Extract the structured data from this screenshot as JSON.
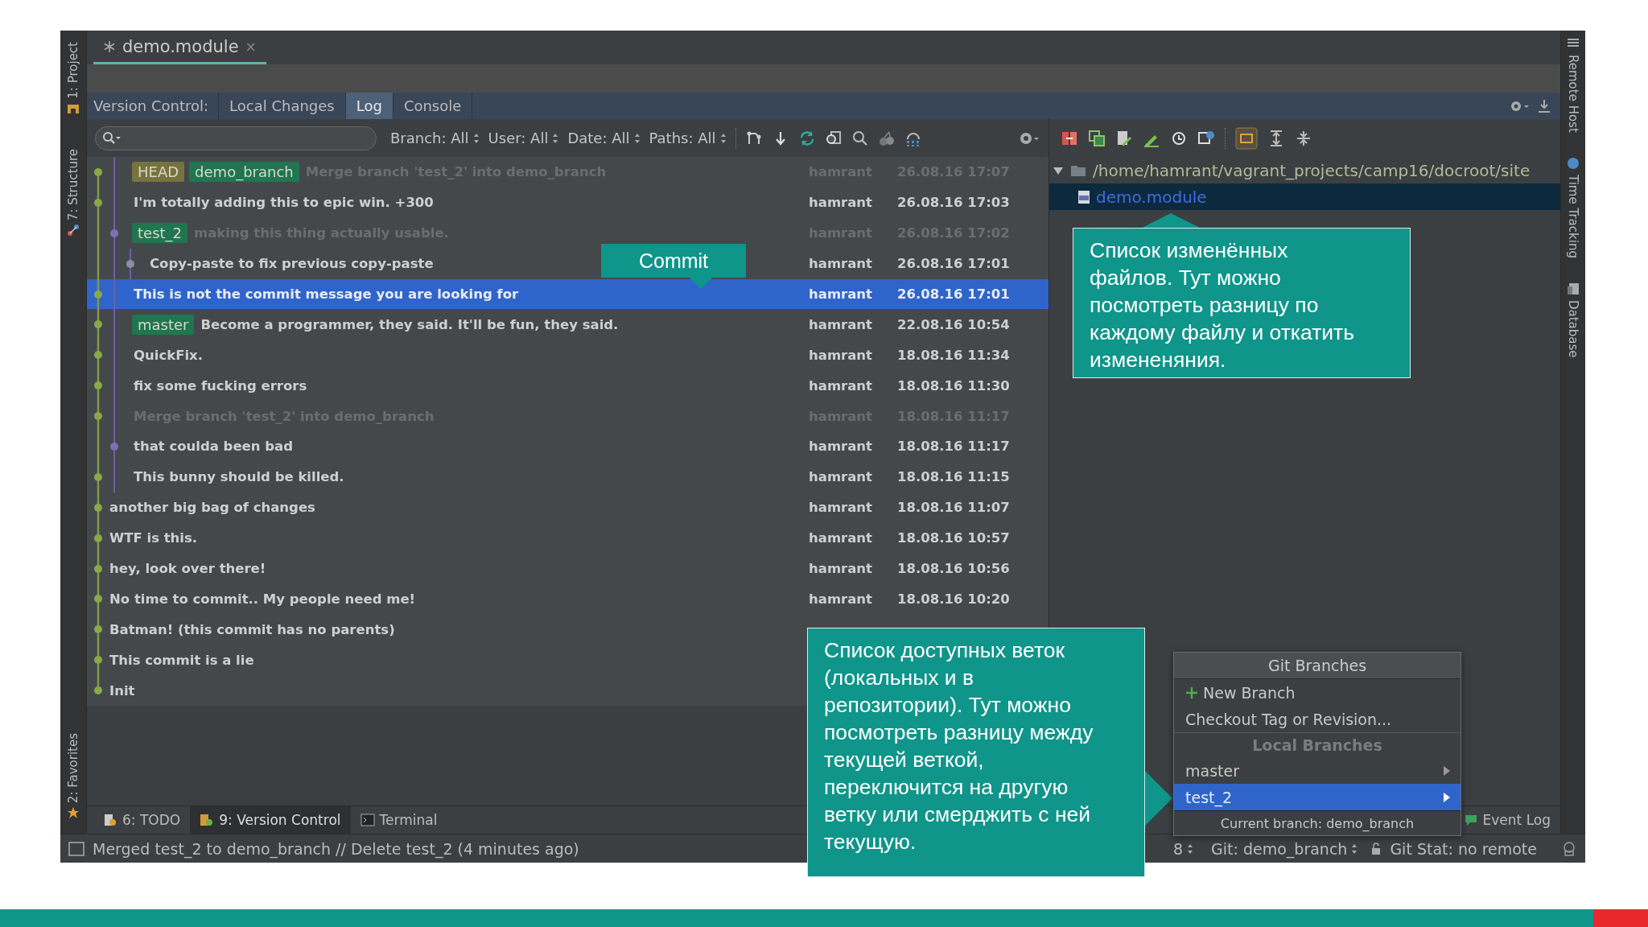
{
  "left_stripe": [
    {
      "label": "1: Project"
    },
    {
      "label": "7: Structure"
    },
    {
      "label": "2: Favorites"
    }
  ],
  "editor_tabs": [
    {
      "label": "demo.module",
      "close": "×",
      "selected": true
    }
  ],
  "vc_panel": {
    "title": "Version Control:",
    "tabs": [
      {
        "label": "Local Changes",
        "selected": false
      },
      {
        "label": "Log",
        "selected": true
      },
      {
        "label": "Console",
        "selected": false
      }
    ]
  },
  "filters": [
    "Branch: All",
    "User: All",
    "Date: All",
    "Paths: All"
  ],
  "log": {
    "rows": [
      {
        "refs": [
          {
            "label": "HEAD",
            "color": "#76733f"
          },
          {
            "label": "demo_branch",
            "color": "#1f7650"
          }
        ],
        "message": "Merge branch 'test_2' into demo_branch",
        "author": "hamrant",
        "date": "26.08.16 17:07",
        "dim": true,
        "selected": false
      },
      {
        "refs": [],
        "message": "I'm totally adding this to epic win. +300",
        "author": "hamrant",
        "date": "26.08.16 17:03",
        "dim": false,
        "selected": false
      },
      {
        "refs": [
          {
            "label": "test_2",
            "color": "#1f7650"
          }
        ],
        "message": "making this thing actually usable.",
        "author": "hamrant",
        "date": "26.08.16 17:02",
        "dim": true,
        "selected": false
      },
      {
        "refs": [],
        "message": "Copy-paste to fix previous copy-paste",
        "author": "hamrant",
        "date": "26.08.16 17:01",
        "dim": false,
        "selected": false
      },
      {
        "refs": [],
        "message": "This is not the commit message you are looking for",
        "author": "hamrant",
        "date": "26.08.16 17:01",
        "dim": false,
        "selected": true
      },
      {
        "refs": [
          {
            "label": "master",
            "color": "#1f7650"
          }
        ],
        "message": "Become a programmer, they said. It'll be fun, they said.",
        "author": "hamrant",
        "date": "22.08.16 10:54",
        "dim": false,
        "selected": false
      },
      {
        "refs": [],
        "message": "QuickFix.",
        "author": "hamrant",
        "date": "18.08.16 11:34",
        "dim": false,
        "selected": false
      },
      {
        "refs": [],
        "message": "fix some fucking errors",
        "author": "hamrant",
        "date": "18.08.16 11:30",
        "dim": false,
        "selected": false
      },
      {
        "refs": [],
        "message": "Merge branch 'test_2' into demo_branch",
        "author": "hamrant",
        "date": "18.08.16 11:17",
        "dim": true,
        "selected": false
      },
      {
        "refs": [],
        "message": "that coulda been bad",
        "author": "hamrant",
        "date": "18.08.16 11:17",
        "dim": false,
        "selected": false
      },
      {
        "refs": [],
        "message": "This bunny should be killed.",
        "author": "hamrant",
        "date": "18.08.16 11:15",
        "dim": false,
        "selected": false
      },
      {
        "refs": [],
        "message": "another big bag of changes",
        "author": "hamrant",
        "date": "18.08.16 11:07",
        "dim": false,
        "selected": false
      },
      {
        "refs": [],
        "message": "WTF is this.",
        "author": "hamrant",
        "date": "18.08.16 10:57",
        "dim": false,
        "selected": false
      },
      {
        "refs": [],
        "message": "hey, look over there!",
        "author": "hamrant",
        "date": "18.08.16 10:56",
        "dim": false,
        "selected": false
      },
      {
        "refs": [],
        "message": "No time to commit.. My people need me!",
        "author": "hamrant",
        "date": "18.08.16 10:20",
        "dim": false,
        "selected": false
      },
      {
        "refs": [],
        "message": "Batman! (this commit has no parents)",
        "dim": false,
        "selected": false
      },
      {
        "refs": [],
        "message": "This commit is a lie",
        "dim": false,
        "selected": false
      },
      {
        "refs": [],
        "message": "Init",
        "dim": false,
        "selected": false
      }
    ]
  },
  "changes": {
    "path": "/home/hamrant/vagrant_projects/camp16/docroot/site",
    "expanded": true,
    "files": [
      {
        "name": "demo.module",
        "selected": true
      }
    ]
  },
  "right_stripe": [
    {
      "label": "Remote Host"
    },
    {
      "label": "Time Tracking"
    },
    {
      "label": "Database"
    }
  ],
  "tool_tabs": [
    {
      "label": "6: TODO",
      "selected": false
    },
    {
      "label": "9: Version Control",
      "selected": true
    },
    {
      "label": "Terminal",
      "selected": false
    }
  ],
  "event_log": "Event Log",
  "status_bar": {
    "message": "Merged test_2 to demo_branch // Delete test_2 (4 minutes ago)",
    "segments": [
      "8",
      "Git: demo_branch"
    ],
    "git_stat": "Git Stat: no remote"
  },
  "branches_popup": {
    "title": "Git Branches",
    "items": [
      {
        "kind": "action",
        "label": "New Branch",
        "selected": false
      },
      {
        "kind": "plain",
        "label": "Checkout Tag or Revision...",
        "selected": false
      },
      {
        "kind": "header",
        "label": "Local Branches",
        "selected": false
      },
      {
        "kind": "branch",
        "label": "master",
        "selected": false
      },
      {
        "kind": "branch",
        "label": "test_2",
        "selected": true
      }
    ],
    "footer": "Current branch: demo_branch"
  },
  "annotations": {
    "commit": "Commit",
    "changes_note": "Список изменённых файлов. Тут можно посмотреть разницу по каждому файлу и откатить измененяния.",
    "branches_note": "Список доступных веток (локальных и в репозитории). Тут можно посмотреть разницу между текущей веткой, переключится на другую ветку или смерджить с ней текущую."
  }
}
